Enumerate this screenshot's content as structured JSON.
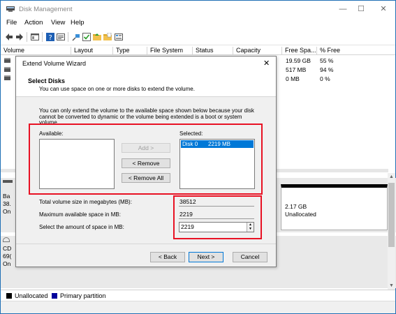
{
  "window": {
    "title": "Disk Management",
    "minimize": "—",
    "maximize": "☐",
    "close": "✕"
  },
  "menu": [
    "File",
    "Action",
    "View",
    "Help"
  ],
  "columns": [
    "Volume",
    "Layout",
    "Type",
    "File System",
    "Status",
    "Capacity",
    "Free Spa...",
    "% Free"
  ],
  "volumes": [
    {
      "free": "19.59 GB",
      "pct": "55 %"
    },
    {
      "free": "517 MB",
      "pct": "94 %"
    },
    {
      "free": "0 MB",
      "pct": "0 %"
    }
  ],
  "disk_pane": {
    "disk_label_1": "Ba",
    "disk_label_2": "38.",
    "disk_label_3": "On",
    "cd_label_1": "CD",
    "cd_label_2": "69(",
    "cd_label_3": "On",
    "unallocated_size": "2.17 GB",
    "unallocated_label": "Unallocated"
  },
  "legend": {
    "unallocated": "Unallocated",
    "primary": "Primary partition",
    "unallocated_color": "#000000",
    "primary_color": "#00009c"
  },
  "dialog": {
    "title": "Extend Volume Wizard",
    "close": "✕",
    "heading": "Select Disks",
    "subheading": "You can use space on one or more disks to extend the volume.",
    "info": "You can only extend the volume to the available space shown below because your disk cannot be converted to dynamic or the volume being extended is a boot or system volume.",
    "available_label": "Available:",
    "selected_label": "Selected:",
    "selected_items": [
      {
        "disk": "Disk 0",
        "size": "2219 MB"
      }
    ],
    "add_button": "Add >",
    "remove_button": "< Remove",
    "remove_all_button": "< Remove All",
    "total_label": "Total volume size in megabytes (MB):",
    "total_value": "38512",
    "max_label": "Maximum available space in MB:",
    "max_value": "2219",
    "amount_label": "Select the amount of space in MB:",
    "amount_value": "2219",
    "back_button": "< Back",
    "next_button": "Next >",
    "cancel_button": "Cancel"
  },
  "colors": {
    "highlight": "#0078d7",
    "annotation": "#e81123"
  }
}
